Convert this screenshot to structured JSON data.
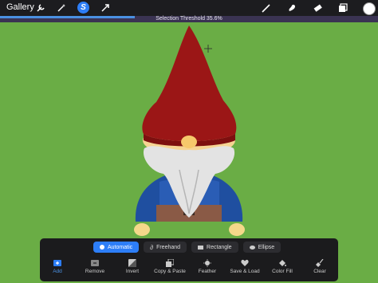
{
  "toolbar": {
    "gallery_label": "Gallery",
    "tools": [
      "wrench-icon",
      "magic-wand-icon",
      "selection-icon",
      "transform-icon"
    ],
    "right_tools": [
      "brush-icon",
      "smudge-icon",
      "eraser-icon",
      "layers-icon"
    ],
    "current_color": "#ffffff",
    "active_color": "#2d7ef7"
  },
  "threshold": {
    "label": "Selection Threshold 35.6%",
    "value_percent": 35.6
  },
  "canvas": {
    "background": "#6aad45"
  },
  "selection_modes": {
    "items": [
      {
        "label": "Automatic",
        "icon": "dot-icon",
        "active": true
      },
      {
        "label": "Freehand",
        "icon": "freehand-icon",
        "active": false
      },
      {
        "label": "Rectangle",
        "icon": "rectangle-icon",
        "active": false
      },
      {
        "label": "Ellipse",
        "icon": "ellipse-icon",
        "active": false
      }
    ]
  },
  "actions": {
    "items": [
      {
        "label": "Add",
        "icon": "add-icon",
        "active": true
      },
      {
        "label": "Remove",
        "icon": "remove-icon",
        "active": false
      },
      {
        "label": "Invert",
        "icon": "invert-icon",
        "active": false
      },
      {
        "label": "Copy & Paste",
        "icon": "copy-paste-icon",
        "active": false
      },
      {
        "label": "Feather",
        "icon": "feather-icon",
        "active": false
      },
      {
        "label": "Save & Load",
        "icon": "heart-icon",
        "active": false
      },
      {
        "label": "Color Fill",
        "icon": "color-fill-icon",
        "active": false
      },
      {
        "label": "Clear",
        "icon": "broom-icon",
        "active": false
      }
    ]
  }
}
